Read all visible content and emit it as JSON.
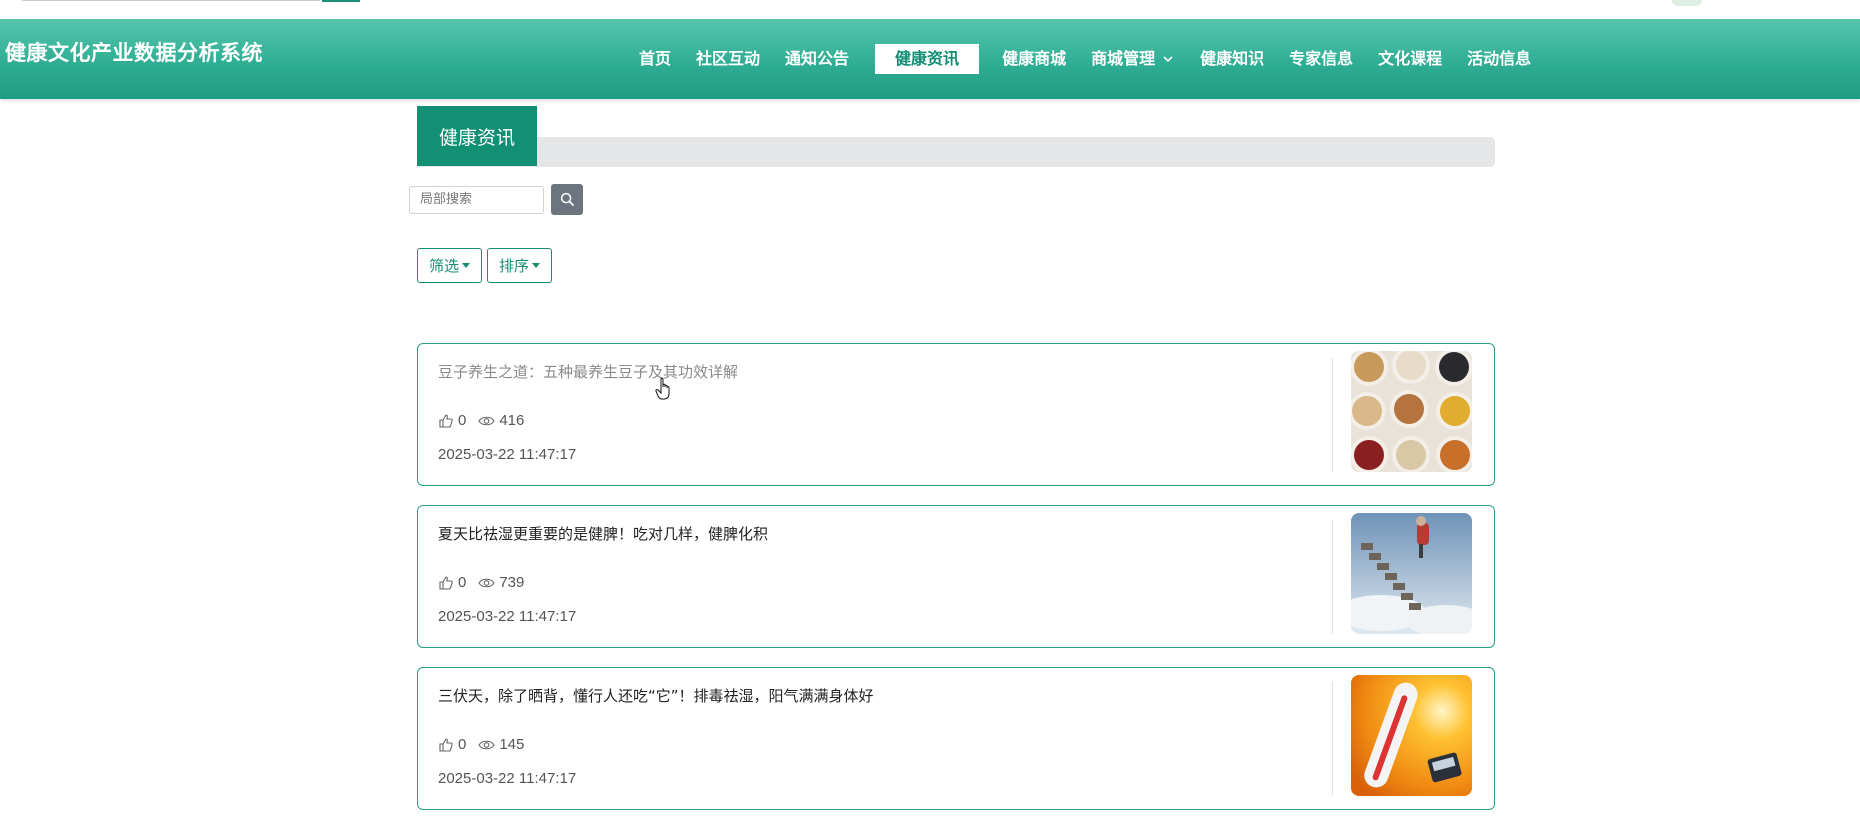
{
  "header": {
    "title": "健康文化产业数据分析系统",
    "nav": [
      {
        "label": "首页"
      },
      {
        "label": "社区互动"
      },
      {
        "label": "通知公告"
      },
      {
        "label": "健康资讯",
        "active": true
      },
      {
        "label": "健康商城"
      },
      {
        "label": "商城管理",
        "dropdown": true
      },
      {
        "label": "健康知识"
      },
      {
        "label": "专家信息"
      },
      {
        "label": "文化课程"
      },
      {
        "label": "活动信息"
      }
    ]
  },
  "section": {
    "title": "健康资讯"
  },
  "search": {
    "placeholder": "局部搜索"
  },
  "tools": {
    "filter_label": "筛选",
    "sort_label": "排序"
  },
  "news": [
    {
      "title": "豆子养生之道：五种最养生豆子及其功效详解",
      "likes": "0",
      "views": "416",
      "time": "2025-03-22 11:47:17",
      "image": "beans-bowls-image"
    },
    {
      "title": "夏天比祛湿更重要的是健脾！吃对几样，健脾化积",
      "likes": "0",
      "views": "739",
      "time": "2025-03-22 11:47:17",
      "image": "stairs-sky-image"
    },
    {
      "title": "三伏天，除了晒背，懂行人还吃“它”！排毒祛湿，阳气满满身体好",
      "likes": "0",
      "views": "145",
      "time": "2025-03-22 11:47:17",
      "image": "sun-thermometer-image"
    }
  ],
  "colors": {
    "brand": "#138f74",
    "header_gradient_top": "#56c6ad",
    "header_gradient_bottom": "#1f9b82",
    "card_border": "#2b9e85"
  }
}
